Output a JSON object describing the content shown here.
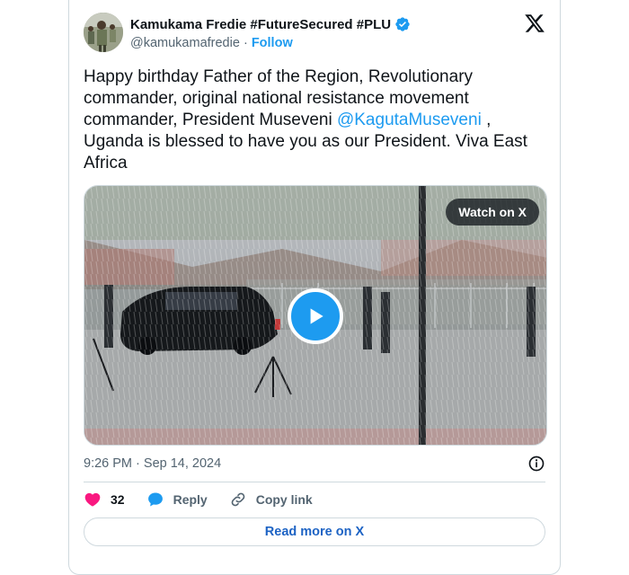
{
  "author": {
    "name": "Kamukama Fredie #FutureSecured #PLU",
    "handle": "@kamukamafredie",
    "separator": "·",
    "follow_label": "Follow"
  },
  "tweet": {
    "text_before": "Happy birthday Father of the Region, Revolutionary commander, original national resistance movement commander, President Museveni ",
    "mention": "@KagutaMuseveni",
    "text_after": " , Uganda is blessed to have you as our President. Viva East Africa"
  },
  "media": {
    "watch_label": "Watch on X"
  },
  "meta": {
    "time": "9:26 PM",
    "separator": "·",
    "date": "Sep 14, 2024"
  },
  "actions": {
    "like_count": "32",
    "reply_label": "Reply",
    "copy_link_label": "Copy link"
  },
  "read_more_label": "Read more on X",
  "colors": {
    "accent": "#1d9bf0",
    "like": "#f91880",
    "text_secondary": "#536471"
  }
}
